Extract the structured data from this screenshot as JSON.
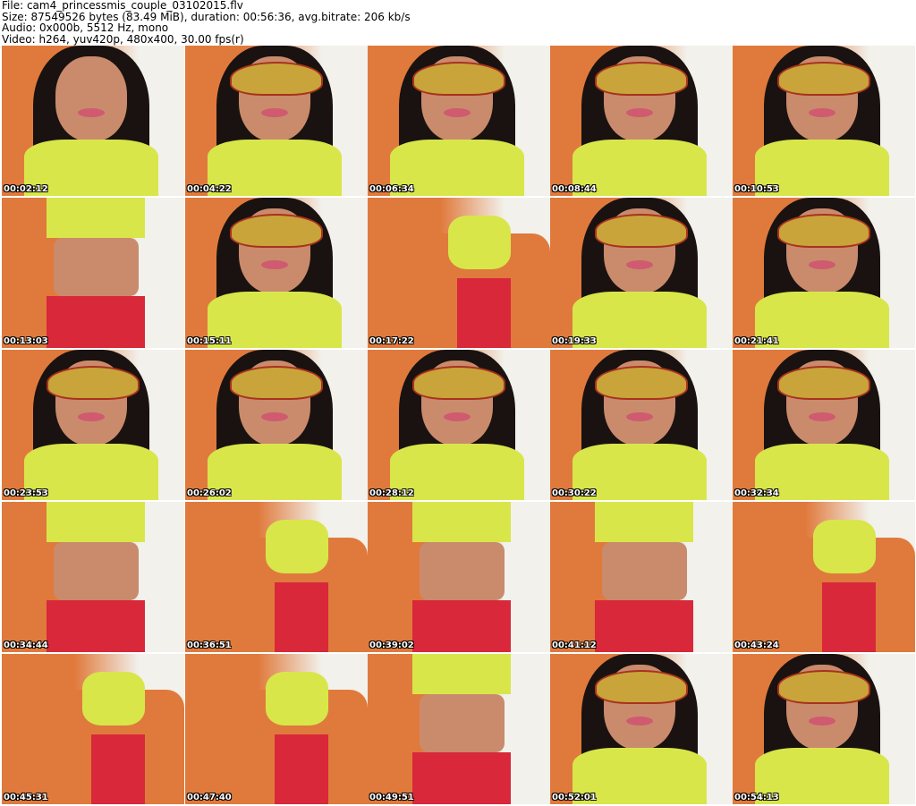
{
  "header": {
    "file": "File: cam4_princessmis_couple_03102015.flv",
    "size": "Size: 87549526 bytes (83.49 MiB), duration: 00:56:36, avg.bitrate: 206 kb/s",
    "audio": "Audio: 0x000b, 5512 Hz, mono",
    "video": "Video: h264, yuv420p, 480x400, 30.00 fps(r)"
  },
  "thumbnails": [
    {
      "time": "00:02:12",
      "scene": "closeup"
    },
    {
      "time": "00:04:22",
      "scene": "mask"
    },
    {
      "time": "00:06:34",
      "scene": "mask"
    },
    {
      "time": "00:08:44",
      "scene": "mask"
    },
    {
      "time": "00:10:53",
      "scene": "mask"
    },
    {
      "time": "00:13:03",
      "scene": "torso"
    },
    {
      "time": "00:15:11",
      "scene": "mask"
    },
    {
      "time": "00:17:22",
      "scene": "couch"
    },
    {
      "time": "00:19:33",
      "scene": "mask"
    },
    {
      "time": "00:21:41",
      "scene": "mask"
    },
    {
      "time": "00:23:53",
      "scene": "mask"
    },
    {
      "time": "00:26:02",
      "scene": "mask"
    },
    {
      "time": "00:28:12",
      "scene": "mask"
    },
    {
      "time": "00:30:22",
      "scene": "mask"
    },
    {
      "time": "00:32:34",
      "scene": "mask"
    },
    {
      "time": "00:34:44",
      "scene": "torso"
    },
    {
      "time": "00:36:51",
      "scene": "couch"
    },
    {
      "time": "00:39:02",
      "scene": "torso"
    },
    {
      "time": "00:41:12",
      "scene": "torso"
    },
    {
      "time": "00:43:24",
      "scene": "couch"
    },
    {
      "time": "00:45:31",
      "scene": "couch"
    },
    {
      "time": "00:47:40",
      "scene": "couch"
    },
    {
      "time": "00:49:51",
      "scene": "torso"
    },
    {
      "time": "00:52:01",
      "scene": "mask"
    },
    {
      "time": "00:54:13",
      "scene": "mask"
    }
  ],
  "colors": {
    "couch": "#e07a3c",
    "shirt": "#d8e64a",
    "pants": "#d8283a",
    "hair": "#1a1210",
    "wall": "#f2f1ec",
    "mask": "#c9a43a",
    "skin": "#c98b6c"
  }
}
